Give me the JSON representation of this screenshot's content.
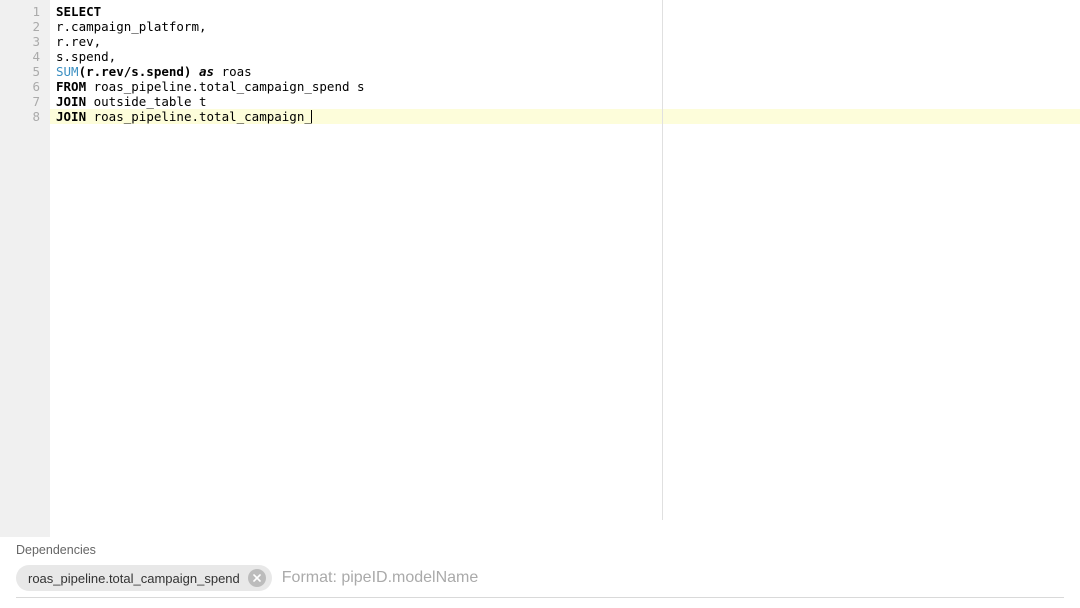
{
  "editor": {
    "gutter_count": 8,
    "lines": [
      {
        "n": 1,
        "tokens": [
          {
            "t": "SELECT",
            "c": "kw"
          }
        ]
      },
      {
        "n": 2,
        "tokens": [
          {
            "t": "r.campaign_platform,",
            "c": ""
          }
        ]
      },
      {
        "n": 3,
        "tokens": [
          {
            "t": "r.rev,",
            "c": ""
          }
        ]
      },
      {
        "n": 4,
        "tokens": [
          {
            "t": "s.spend,",
            "c": ""
          }
        ]
      },
      {
        "n": 5,
        "tokens": [
          {
            "t": "SUM",
            "c": "fn"
          },
          {
            "t": "(r.rev/s.spend) ",
            "c": "kw"
          },
          {
            "t": "as",
            "c": "kw em"
          },
          {
            "t": " roas",
            "c": ""
          }
        ]
      },
      {
        "n": 6,
        "tokens": [
          {
            "t": "FROM",
            "c": "kw"
          },
          {
            "t": " roas_pipeline.total_campaign_spend s",
            "c": ""
          }
        ]
      },
      {
        "n": 7,
        "tokens": [
          {
            "t": "JOIN",
            "c": "kw"
          },
          {
            "t": " outside_table t",
            "c": ""
          }
        ]
      },
      {
        "n": 8,
        "tokens": [
          {
            "t": "JOIN",
            "c": "kw"
          },
          {
            "t": " roas_pipeline.total_campaign_",
            "c": ""
          }
        ],
        "highlight": true,
        "cursor": true
      }
    ]
  },
  "deps": {
    "label": "Dependencies",
    "chips": [
      {
        "label": "roas_pipeline.total_campaign_spend"
      }
    ],
    "input_placeholder": "Format: pipeID.modelName",
    "input_value": ""
  }
}
